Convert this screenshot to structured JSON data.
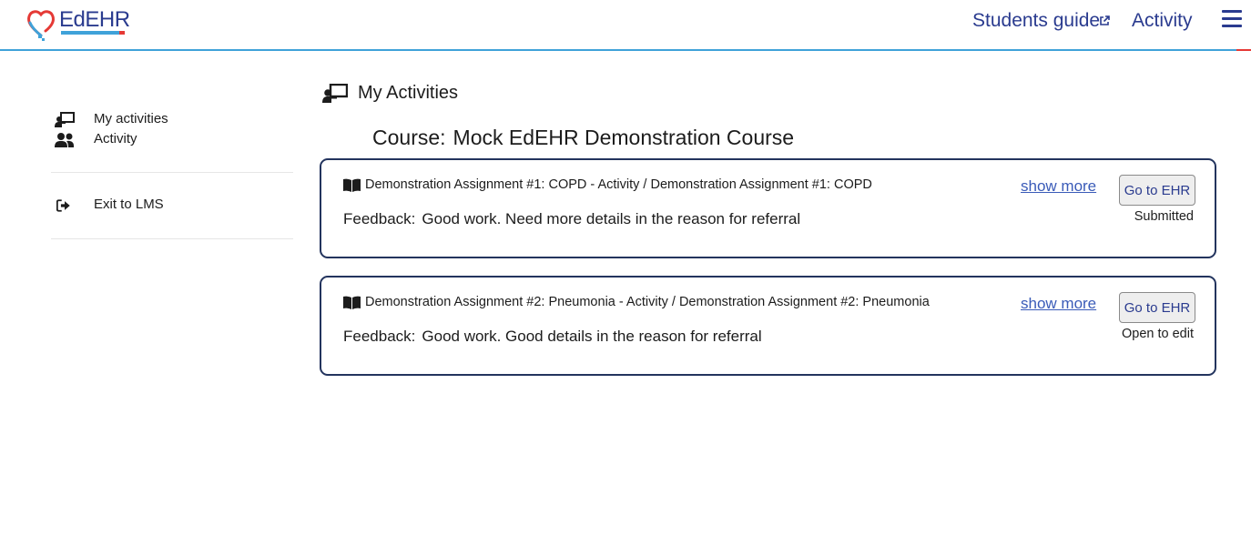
{
  "header": {
    "logo_text": "EdEHR",
    "nav": {
      "students_guide": "Students guide",
      "activity": "Activity"
    },
    "icons": {
      "external_link": "external-link-icon",
      "menu": "hamburger-menu-icon"
    },
    "colors": {
      "brand_blue": "#2a3b8f",
      "accent_light_blue": "#3fa2d9",
      "accent_red": "#e53935"
    }
  },
  "sidebar": {
    "items": [
      {
        "label": "My activities",
        "icon": "chalkboard-teacher-icon"
      },
      {
        "label": "Activity",
        "icon": "users-icon"
      },
      {
        "label": "Exit to LMS",
        "icon": "sign-out-icon"
      }
    ]
  },
  "main": {
    "title": "My Activities",
    "title_icon": "chalkboard-teacher-icon",
    "course_label": "Course:",
    "course_name": "Mock EdEHR Demonstration Course",
    "activities": [
      {
        "title": "Demonstration Assignment #1: COPD - Activity / Demonstration Assignment #1: COPD",
        "feedback_label": "Feedback:",
        "feedback": "Good work. Need more details in the reason for referral",
        "show_more": "show more",
        "button": "Go to EHR",
        "status": "Submitted",
        "icon": "book-open-icon"
      },
      {
        "title": "Demonstration Assignment #2: Pneumonia - Activity / Demonstration Assignment #2: Pneumonia",
        "feedback_label": "Feedback:",
        "feedback": "Good work. Good details in the reason for referral",
        "show_more": "show more",
        "button": "Go to EHR",
        "status": "Open to edit",
        "icon": "book-open-icon"
      }
    ],
    "colors": {
      "card_border": "#23345e",
      "link": "#3a5bb8"
    }
  }
}
